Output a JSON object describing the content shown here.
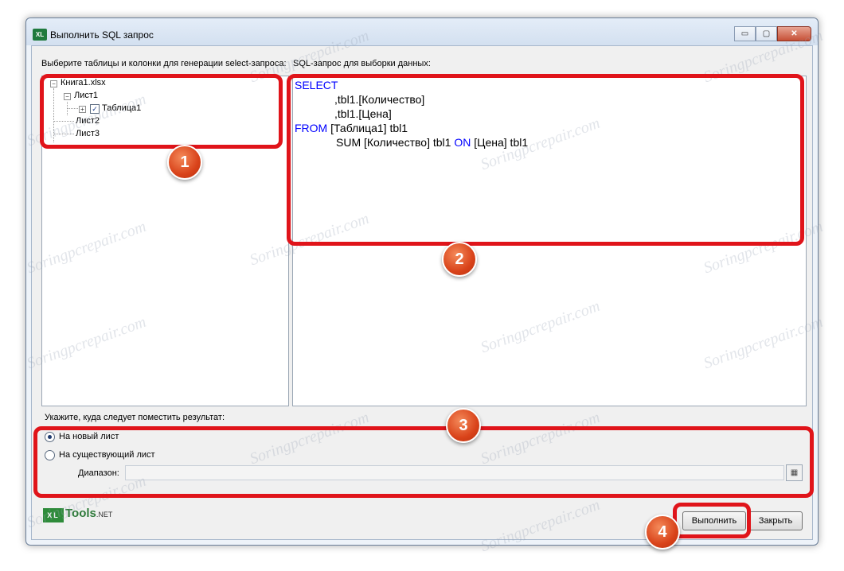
{
  "window": {
    "title": "Выполнить SQL запрос",
    "app_icon": "XL",
    "controls": {
      "minimize": "▭",
      "maximize": "▢",
      "close": "✕"
    }
  },
  "left_label": "Выберите таблицы и колонки для генерации select-запроса:",
  "right_label": "SQL-запрос для выборки данных:",
  "tree": {
    "book": "Книга1.xlsx",
    "sheet1": "Лист1",
    "table1": "Таблица1",
    "sheet2": "Лист2",
    "sheet3": "Лист3",
    "expander_open": "−",
    "expander_closed": "+",
    "check": "✓"
  },
  "sql": {
    "select": "SELECT",
    "line2": ",tbl1.[Количество]",
    "line3": ",tbl1.[Цена]",
    "from": "FROM",
    "line4_rest": "[Таблица1] tbl1",
    "line5_a": "SUM [Количество] tbl1",
    "on": "ON",
    "line5_b": "[Цена] tbl1"
  },
  "result": {
    "label": "Укажите, куда следует поместить результат:",
    "option_new": "На новый лист",
    "option_existing": "На существующий лист",
    "selected": "new",
    "range_label": "Диапазон:",
    "range_value": ""
  },
  "logo": {
    "xl": "XL",
    "tools": "Tools",
    "net": ".NET"
  },
  "buttons": {
    "run": "Выполнить",
    "close": "Закрыть"
  },
  "annotations": [
    "1",
    "2",
    "3",
    "4"
  ],
  "watermark": "Soringpcrepair.com",
  "colors": {
    "annotation": "#e0141a",
    "keyword": "#0000ff",
    "badge": "#d9431a"
  }
}
